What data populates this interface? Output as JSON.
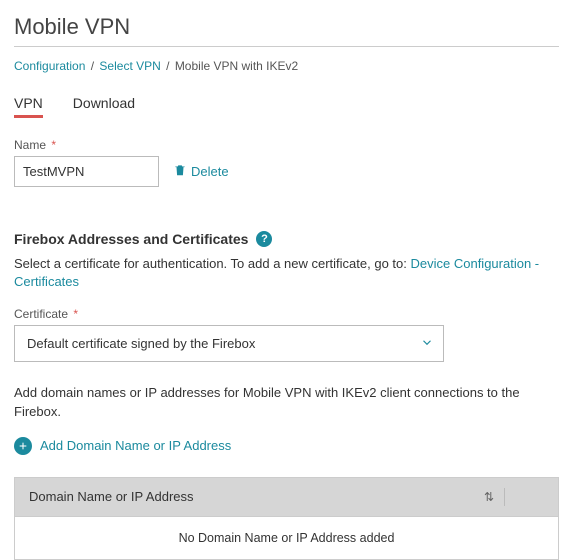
{
  "page": {
    "title": "Mobile VPN"
  },
  "breadcrumb": {
    "items": [
      {
        "label": "Configuration"
      },
      {
        "label": "Select VPN"
      }
    ],
    "current": "Mobile VPN with IKEv2",
    "sep": "/"
  },
  "tabs": {
    "items": [
      {
        "label": "VPN",
        "active": true
      },
      {
        "label": "Download",
        "active": false
      }
    ]
  },
  "name": {
    "label": "Name",
    "required": "*",
    "value": "TestMVPN",
    "delete_label": "Delete"
  },
  "firebox": {
    "heading": "Firebox Addresses and Certificates",
    "help_glyph": "?",
    "desc_prefix": "Select a certificate for authentication. To add a new certificate, go to: ",
    "desc_link": "Device Configuration - Certificates",
    "cert_label": "Certificate",
    "cert_required": "*",
    "cert_value": "Default certificate signed by the Firebox",
    "domain_desc": "Add domain names or IP addresses for Mobile VPN with IKEv2 client connections to the Firebox.",
    "add_label": "Add Domain Name or IP Address",
    "table_col": "Domain Name or IP Address",
    "sort_glyph": "⇅",
    "table_empty": "No Domain Name or IP Address added"
  }
}
